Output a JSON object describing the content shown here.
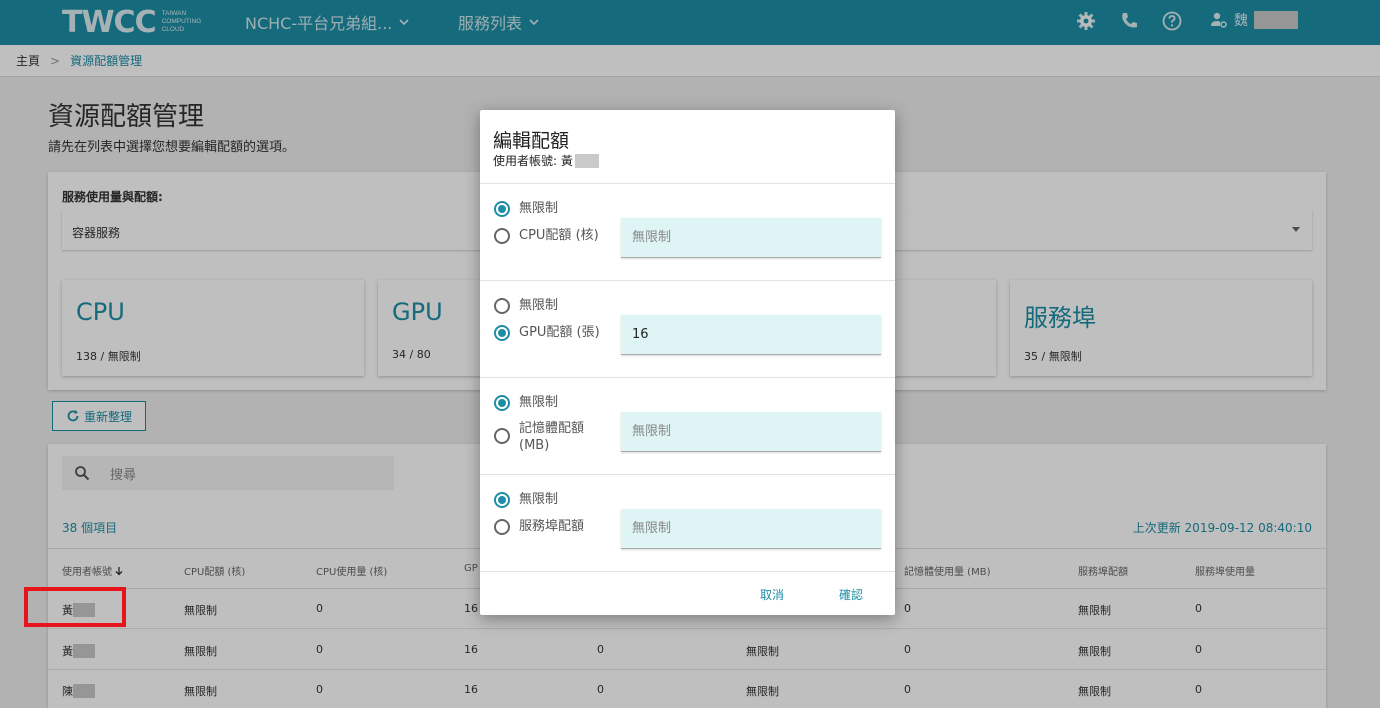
{
  "header": {
    "logo_text": "TWCC",
    "logo_sub": [
      "TAIWAN",
      "COMPUTING",
      "CLOUD"
    ],
    "project_label": "NCHC-平台兄弟組...",
    "services_label": "服務列表",
    "user_name": "魏"
  },
  "breadcrumb": {
    "home": "主頁",
    "separator": ">",
    "current": "資源配額管理"
  },
  "page": {
    "title": "資源配額管理",
    "subtitle": "請先在列表中選擇您想要編輯配額的選項。"
  },
  "usage_panel": {
    "label": "服務使用量與配額:",
    "selected_service": "容器服務",
    "cards": [
      {
        "title": "CPU",
        "value": "138 / 無限制"
      },
      {
        "title": "GPU",
        "value": "34 / 80"
      },
      {
        "title": "服務埠",
        "value": "35 / 無限制"
      }
    ]
  },
  "refresh_label": "重新整理",
  "table": {
    "search_placeholder": "搜尋",
    "count_text": "38 個項目",
    "updated_text": "上次更新 2019-09-12 08:40:10",
    "headers": [
      "使用者帳號",
      "CPU配額 (核)",
      "CPU使用量 (核)",
      "GP",
      "記憶體使用量 (MB)",
      "服務埠配額",
      "服務埠使用量"
    ],
    "rows": [
      {
        "user": "黃",
        "cpu_quota": "無限制",
        "cpu_used": "0",
        "gpu": "16",
        "col5": "",
        "mem_quota": "",
        "mem_used": "0",
        "port_quota": "無限制",
        "port_used": "0"
      },
      {
        "user": "黃",
        "cpu_quota": "無限制",
        "cpu_used": "0",
        "gpu": "16",
        "col5": "0",
        "mem_quota": "無限制",
        "mem_used": "0",
        "port_quota": "無限制",
        "port_used": "0"
      },
      {
        "user": "陳",
        "cpu_quota": "無限制",
        "cpu_used": "0",
        "gpu": "16",
        "col5": "0",
        "mem_quota": "無限制",
        "mem_used": "0",
        "port_quota": "無限制",
        "port_used": "0"
      }
    ]
  },
  "dialog": {
    "title": "編輯配額",
    "subtitle_prefix": "使用者帳號: 黃",
    "sections": [
      {
        "unlimited_label": "無限制",
        "quota_label": "CPU配額 (核)",
        "value": "",
        "placeholder": "無限制",
        "selected": "unlimited"
      },
      {
        "unlimited_label": "無限制",
        "quota_label": "GPU配額 (張)",
        "value": "16",
        "placeholder": "無限制",
        "selected": "quota"
      },
      {
        "unlimited_label": "無限制",
        "quota_label": "記憶體配額 (MB)",
        "value": "",
        "placeholder": "無限制",
        "selected": "unlimited"
      },
      {
        "unlimited_label": "無限制",
        "quota_label": "服務埠配額",
        "value": "",
        "placeholder": "無限制",
        "selected": "unlimited"
      }
    ],
    "cancel_label": "取消",
    "confirm_label": "確認"
  },
  "colors": {
    "brand": "#1d8ea6",
    "highlight": "#e8141b",
    "input_bg": "#dff4f4"
  }
}
